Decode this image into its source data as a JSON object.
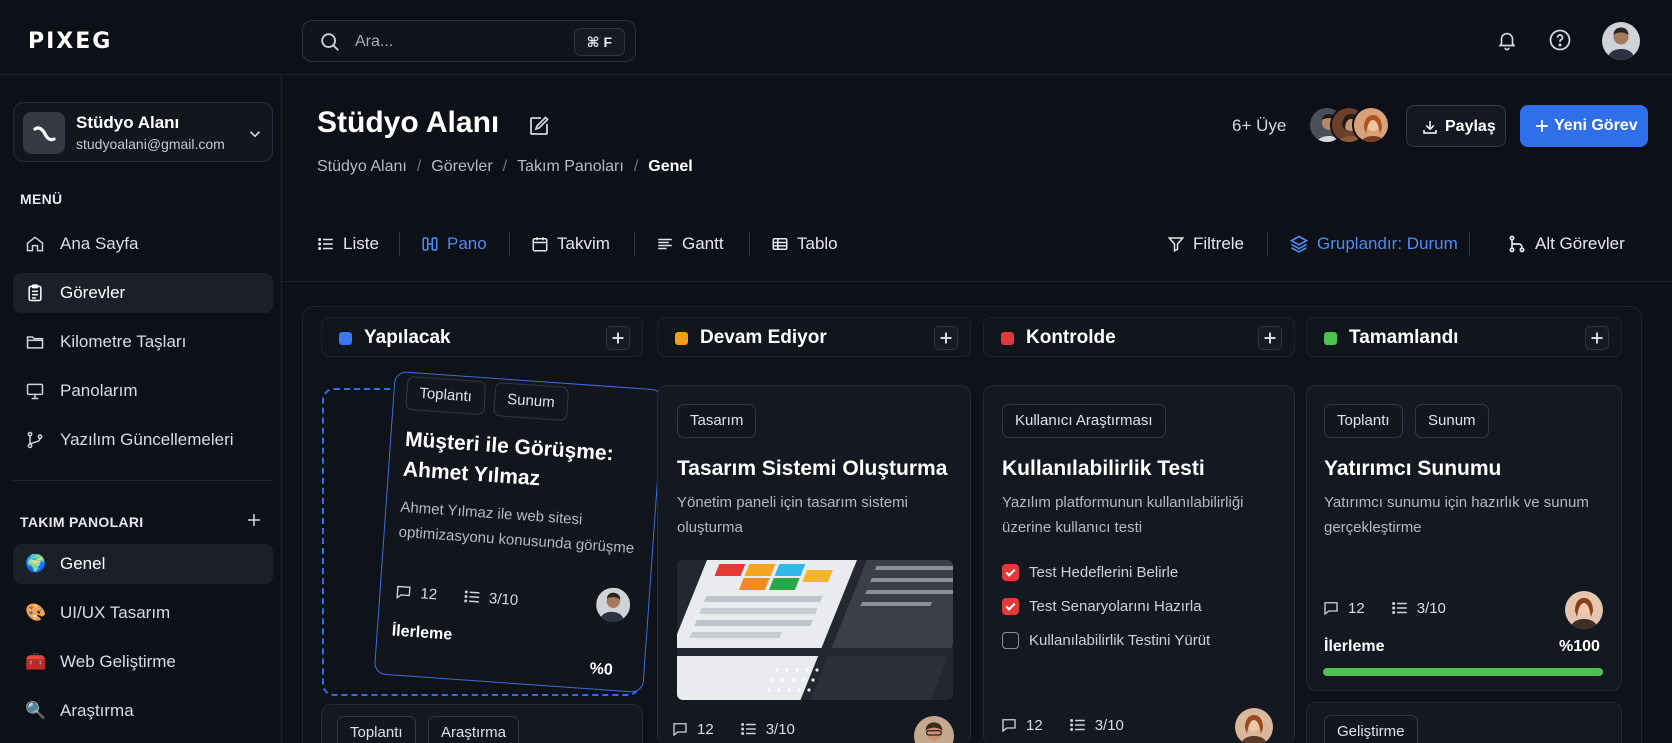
{
  "app": {
    "logo": "PIXEG"
  },
  "search": {
    "placeholder": "Ara...",
    "shortcut": "⌘ F"
  },
  "workspace": {
    "name": "Stüdyo Alanı",
    "email": "studyoalani@gmail.com"
  },
  "sidebar": {
    "menu_title": "MENÜ",
    "menu": [
      {
        "label": "Ana Sayfa",
        "icon": "home-icon"
      },
      {
        "label": "Görevler",
        "icon": "clipboard-icon"
      },
      {
        "label": "Kilometre Taşları",
        "icon": "folder-icon"
      },
      {
        "label": "Panolarım",
        "icon": "board-icon"
      },
      {
        "label": "Yazılım Güncellemeleri",
        "icon": "branch-icon"
      }
    ],
    "teams_title": "TAKIM PANOLARI",
    "teams": [
      {
        "label": "Genel",
        "icon": "🌍"
      },
      {
        "label": "UI/UX Tasarım",
        "icon": "🎨"
      },
      {
        "label": "Web Geliştirme",
        "icon": "🧰"
      },
      {
        "label": "Araştırma",
        "icon": "🔍"
      }
    ]
  },
  "header": {
    "title": "Stüdyo Alanı",
    "breadcrumbs": [
      "Stüdyo Alanı",
      "Görevler",
      "Takım Panoları",
      "Genel"
    ],
    "members": "6+ Üye",
    "share": "Paylaş",
    "new_task": "Yeni Görev"
  },
  "views": {
    "list": "Liste",
    "board": "Pano",
    "calendar": "Takvim",
    "gantt": "Gantt",
    "table": "Tablo",
    "filter": "Filtrele",
    "group": "Gruplandır: Durum",
    "subtasks": "Alt Görevler"
  },
  "columns": [
    {
      "label": "Yapılacak",
      "color": "#3a78f2"
    },
    {
      "label": "Devam Ediyor",
      "color": "#f39c1e"
    },
    {
      "label": "Kontrolde",
      "color": "#e03a3a"
    },
    {
      "label": "Tamamlandı",
      "color": "#4ec24e"
    }
  ],
  "drag_card": {
    "tags": [
      "Toplantı",
      "Sunum"
    ],
    "title": "Müşteri ile Görüşme: Ahmet Yılmaz",
    "desc": "Ahmet Yılmaz ile web sitesi optimizasyonu konusunda görüşme",
    "comments": "12",
    "subtasks": "3/10",
    "progress_label": "İlerleme",
    "progress_value": "%0"
  },
  "todo_next": {
    "tags": [
      "Toplantı",
      "Araştırma"
    ]
  },
  "inprogress_card": {
    "tag": "Tasarım",
    "title": "Tasarım Sistemi Oluşturma",
    "desc": "Yönetim paneli için tasarım sistemi oluşturma",
    "comments": "12",
    "subtasks": "3/10"
  },
  "review_card": {
    "tag": "Kullanıcı Araştırması",
    "title": "Kullanılabilirlik Testi",
    "desc": "Yazılım platformunun kullanılabilirliği üzerine kullanıcı testi",
    "checklist": [
      {
        "label": "Test Hedeflerini Belirle",
        "done": true
      },
      {
        "label": "Test Senaryolarını Hazırla",
        "done": true
      },
      {
        "label": "Kullanılabilirlik Testini Yürüt",
        "done": false
      }
    ],
    "comments": "12",
    "subtasks": "3/10"
  },
  "done_card": {
    "tags": [
      "Toplantı",
      "Sunum"
    ],
    "title": "Yatırımcı Sunumu",
    "desc": "Yatırımcı sunumu için hazırlık ve sunum gerçekleştirme",
    "comments": "12",
    "subtasks": "3/10",
    "progress_label": "İlerleme",
    "progress_value": "%100",
    "progress": 1.0
  },
  "done_next": {
    "tag": "Geliştirme"
  }
}
